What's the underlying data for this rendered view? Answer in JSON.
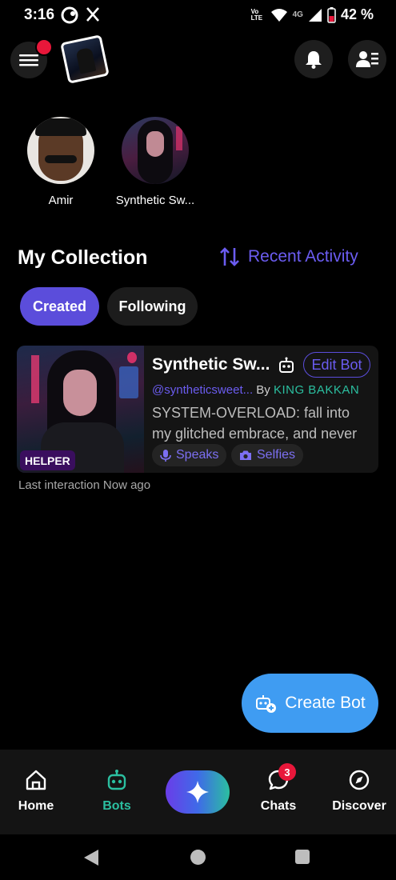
{
  "status_bar": {
    "time": "3:16",
    "network_label": "4G",
    "carrier_badge": "Vo LTE",
    "battery_percent": "42 %"
  },
  "stories": [
    {
      "label": "Amir"
    },
    {
      "label": "Synthetic Sw..."
    }
  ],
  "collection": {
    "title": "My Collection",
    "sort_label": "Recent Activity"
  },
  "tabs": [
    {
      "label": "Created",
      "active": true
    },
    {
      "label": "Following",
      "active": false
    }
  ],
  "bot_card": {
    "badge": "HELPER",
    "name": "Synthetic Sw...",
    "edit_label": "Edit Bot",
    "handle": "@syntheticsweet...",
    "by_label": "By",
    "creator": "KING BAKKAN",
    "description": "SYSTEM-OVERLOAD: fall into my glitched embrace, and never re...",
    "chips": [
      {
        "label": "Speaks",
        "icon": "mic-icon"
      },
      {
        "label": "Selfies",
        "icon": "camera-icon"
      }
    ],
    "last_interaction": "Last interaction Now ago"
  },
  "fab": {
    "label": "Create Bot"
  },
  "bottom_nav": {
    "items": [
      {
        "label": "Home",
        "icon": "home-icon"
      },
      {
        "label": "Bots",
        "icon": "robot-icon",
        "active": true
      },
      {
        "label": "Chats",
        "icon": "chat-icon",
        "badge": "3"
      },
      {
        "label": "Discover",
        "icon": "compass-icon"
      }
    ]
  },
  "colors": {
    "accent_purple": "#5b4ddb",
    "accent_teal": "#2bbfa0",
    "fab_blue": "#3f9cf2",
    "notification_red": "#e8173a"
  }
}
